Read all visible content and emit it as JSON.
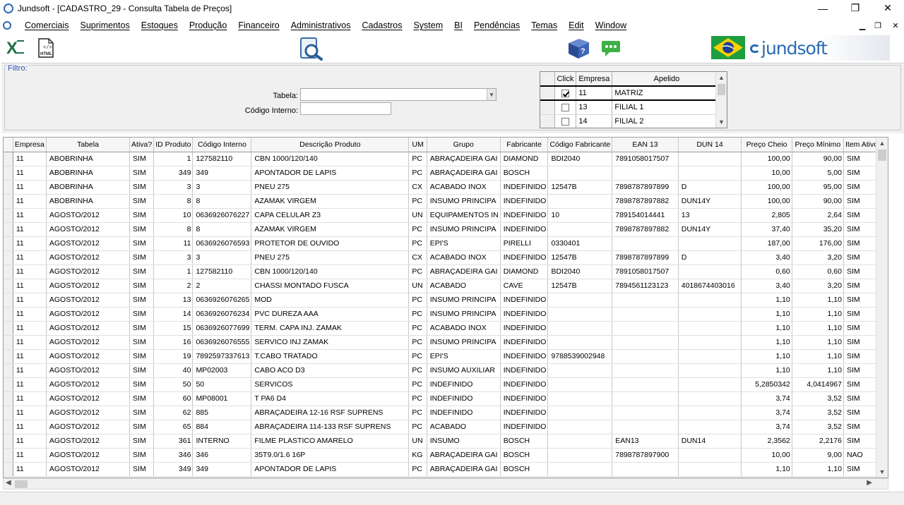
{
  "window": {
    "title": "Jundsoft - [CADASTRO_29 - Consulta Tabela de Preços]",
    "minimize": "—",
    "maximize": "❐",
    "close": "✕"
  },
  "menu": {
    "items": [
      "Comerciais",
      "Suprimentos",
      "Estoques",
      "Produção",
      "Financeiro",
      "Administrativos",
      "Cadastros",
      "System",
      "BI",
      "Pendências",
      "Temas",
      "Edit",
      "Window"
    ],
    "mdi_min": "▁",
    "mdi_restore": "❐",
    "mdi_close": "✕"
  },
  "toolbar": {
    "html_label": "HTML",
    "brand": "jundsoft"
  },
  "filter": {
    "legend": "Filtro:",
    "tabela_label": "Tabela:",
    "tabela_value": "",
    "codigo_label": "Código Interno:",
    "codigo_value": ""
  },
  "empresas": {
    "headers": [
      "Click",
      "Empresa",
      "Apelido"
    ],
    "rows": [
      {
        "checked": true,
        "empresa": "11",
        "apelido": "MATRIZ"
      },
      {
        "checked": false,
        "empresa": "13",
        "apelido": "FILIAL 1"
      },
      {
        "checked": false,
        "empresa": "14",
        "apelido": "FILIAL 2"
      }
    ]
  },
  "grid": {
    "headers": [
      "Empresa",
      "Tabela",
      "Ativa?",
      "ID Produto",
      "Código Interno",
      "Descrição Produto",
      "UM",
      "Grupo",
      "Fabricante",
      "Código Fabricante",
      "EAN 13",
      "DUN 14",
      "Preço Cheio",
      "Preço Mínimo",
      "Item Ativo?"
    ],
    "rows": [
      [
        "11",
        "ABOBRINHA",
        "SIM",
        "1",
        "127582110",
        "CBN 1000/120/140",
        "PC",
        "ABRAÇADEIRA GAI",
        "DIAMOND",
        "BDI2040",
        "7891058017507",
        "",
        "100,00",
        "90,00",
        "SIM"
      ],
      [
        "11",
        "ABOBRINHA",
        "SIM",
        "349",
        "349",
        "APONTADOR DE LAPIS",
        "PC",
        "ABRAÇADEIRA GAI",
        "BOSCH",
        "",
        "",
        "",
        "10,00",
        "5,00",
        "SIM"
      ],
      [
        "11",
        "ABOBRINHA",
        "SIM",
        "3",
        "3",
        "PNEU 275",
        "CX",
        "ACABADO INOX",
        "INDEFINIDO",
        "12547B",
        "7898787897899",
        "D",
        "100,00",
        "95,00",
        "SIM"
      ],
      [
        "11",
        "ABOBRINHA",
        "SIM",
        "8",
        "8",
        "AZAMAK VIRGEM",
        "PC",
        "INSUMO PRINCIPA",
        "INDEFINIDO",
        "",
        "7898787897882",
        "DUN14Y",
        "100,00",
        "90,00",
        "SIM"
      ],
      [
        "11",
        "AGOSTO/2012",
        "SIM",
        "10",
        "0636926076227",
        "CAPA CELULAR Z3",
        "UN",
        "EQUIPAMENTOS IN",
        "INDEFINIDO",
        "10",
        "789154014441",
        "13",
        "2,805",
        "2,64",
        "SIM"
      ],
      [
        "11",
        "AGOSTO/2012",
        "SIM",
        "8",
        "8",
        "AZAMAK VIRGEM",
        "PC",
        "INSUMO PRINCIPA",
        "INDEFINIDO",
        "",
        "7898787897882",
        "DUN14Y",
        "37,40",
        "35,20",
        "SIM"
      ],
      [
        "11",
        "AGOSTO/2012",
        "SIM",
        "11",
        "0636926076593",
        "PROTETOR DE OUVIDO",
        "PC",
        "EPI'S",
        "PIRELLI",
        "0330401",
        "",
        "",
        "187,00",
        "176,00",
        "SIM"
      ],
      [
        "11",
        "AGOSTO/2012",
        "SIM",
        "3",
        "3",
        "PNEU 275",
        "CX",
        "ACABADO INOX",
        "INDEFINIDO",
        "12547B",
        "7898787897899",
        "D",
        "3,40",
        "3,20",
        "SIM"
      ],
      [
        "11",
        "AGOSTO/2012",
        "SIM",
        "1",
        "127582110",
        "CBN 1000/120/140",
        "PC",
        "ABRAÇADEIRA GAI",
        "DIAMOND",
        "BDI2040",
        "7891058017507",
        "",
        "0,60",
        "0,60",
        "SIM"
      ],
      [
        "11",
        "AGOSTO/2012",
        "SIM",
        "2",
        "2",
        "CHASSI MONTADO FUSCA",
        "UN",
        "ACABADO",
        "CAVE",
        "12547B",
        "7894561123123",
        "4018674403016",
        "3,40",
        "3,20",
        "SIM"
      ],
      [
        "11",
        "AGOSTO/2012",
        "SIM",
        "13",
        "0636926076265",
        "MOD",
        "PC",
        "INSUMO PRINCIPA",
        "INDEFINIDO",
        "",
        "",
        "",
        "1,10",
        "1,10",
        "SIM"
      ],
      [
        "11",
        "AGOSTO/2012",
        "SIM",
        "14",
        "0636926076234",
        "PVC DUREZA AAA",
        "PC",
        "INSUMO PRINCIPA",
        "INDEFINIDO",
        "",
        "",
        "",
        "1,10",
        "1,10",
        "SIM"
      ],
      [
        "11",
        "AGOSTO/2012",
        "SIM",
        "15",
        "0636926077699",
        "TERM. CAPA INJ. ZAMAK",
        "PC",
        "ACABADO INOX",
        "INDEFINIDO",
        "",
        "",
        "",
        "1,10",
        "1,10",
        "SIM"
      ],
      [
        "11",
        "AGOSTO/2012",
        "SIM",
        "16",
        "0636926076555",
        "SERVICO INJ ZAMAK",
        "PC",
        "INSUMO PRINCIPA",
        "INDEFINIDO",
        "",
        "",
        "",
        "1,10",
        "1,10",
        "SIM"
      ],
      [
        "11",
        "AGOSTO/2012",
        "SIM",
        "19",
        "7892597337613",
        "T.CABO TRATADO",
        "PC",
        "EPI'S",
        "INDEFINIDO",
        "9788539002948",
        "",
        "",
        "1,10",
        "1,10",
        "SIM"
      ],
      [
        "11",
        "AGOSTO/2012",
        "SIM",
        "40",
        "MP02003",
        "CABO ACO D3",
        "PC",
        "INSUMO AUXILIAR",
        "INDEFINIDO",
        "",
        "",
        "",
        "1,10",
        "1,10",
        "SIM"
      ],
      [
        "11",
        "AGOSTO/2012",
        "SIM",
        "50",
        "50",
        "SERVICOS",
        "PC",
        "INDEFINIDO",
        "INDEFINIDO",
        "",
        "",
        "",
        "5,2850342",
        "4,0414967",
        "SIM"
      ],
      [
        "11",
        "AGOSTO/2012",
        "SIM",
        "60",
        "MP08001",
        "T PA6 D4",
        "PC",
        "INDEFINIDO",
        "INDEFINIDO",
        "",
        "",
        "",
        "3,74",
        "3,52",
        "SIM"
      ],
      [
        "11",
        "AGOSTO/2012",
        "SIM",
        "62",
        "885",
        "ABRAÇADEIRA 12-16 RSF SUPRENS",
        "PC",
        "INDEFINIDO",
        "INDEFINIDO",
        "",
        "",
        "",
        "3,74",
        "3,52",
        "SIM"
      ],
      [
        "11",
        "AGOSTO/2012",
        "SIM",
        "65",
        "884",
        "ABRAÇADEIRA 114-133 RSF SUPRENS",
        "PC",
        "ACABADO",
        "INDEFINIDO",
        "",
        "",
        "",
        "3,74",
        "3,52",
        "SIM"
      ],
      [
        "11",
        "AGOSTO/2012",
        "SIM",
        "361",
        "INTERNO",
        "FILME PLASTICO AMARELO",
        "UN",
        "INSUMO",
        "BOSCH",
        "",
        "EAN13",
        "DUN14",
        "2,3562",
        "2,2176",
        "SIM"
      ],
      [
        "11",
        "AGOSTO/2012",
        "SIM",
        "346",
        "346",
        "35T9.0/1.6 16P",
        "KG",
        "ABRAÇADEIRA GAI",
        "BOSCH",
        "",
        "7898787897900",
        "",
        "10,00",
        "9,00",
        "NAO"
      ],
      [
        "11",
        "AGOSTO/2012",
        "SIM",
        "349",
        "349",
        "APONTADOR DE LAPIS",
        "PC",
        "ABRAÇADEIRA GAI",
        "BOSCH",
        "",
        "",
        "",
        "1,10",
        "1,10",
        "SIM"
      ]
    ]
  },
  "colors": {
    "excel": "#1e7145",
    "help": "#3b5ea8",
    "chat": "#3cb043",
    "brand": "#2a6ab0",
    "legend": "#3050c0"
  }
}
